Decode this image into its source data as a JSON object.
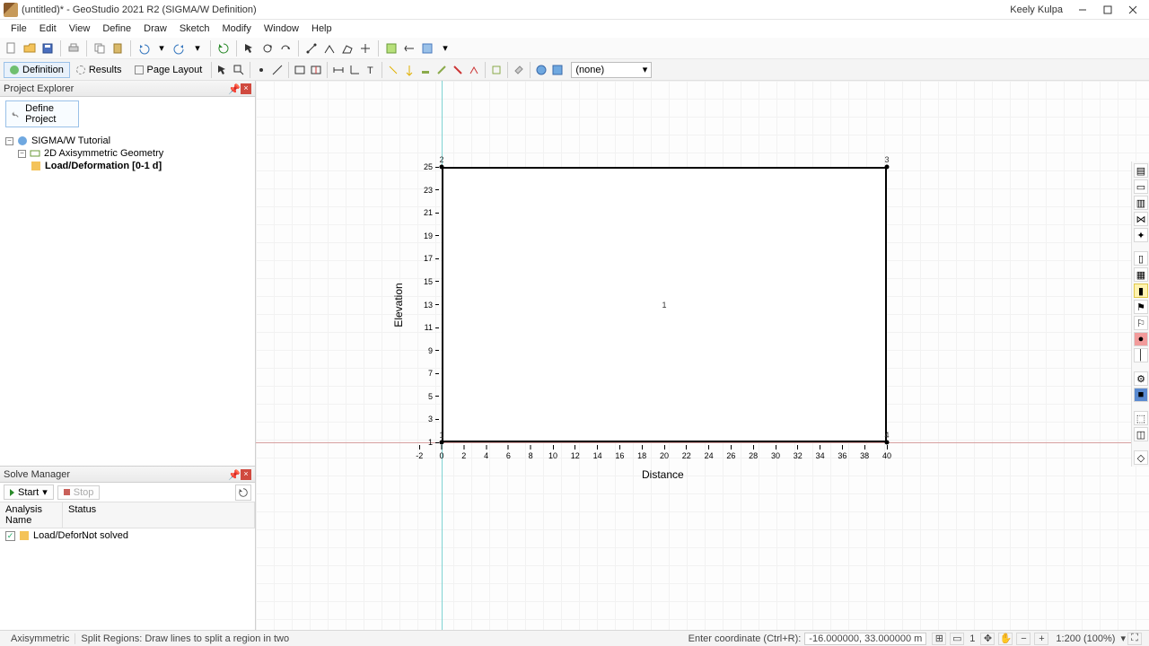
{
  "window": {
    "title": "(untitled)* - GeoStudio 2021 R2 (SIGMA/W Definition)",
    "user": "Keely Kulpa"
  },
  "menu": [
    "File",
    "Edit",
    "View",
    "Define",
    "Draw",
    "Sketch",
    "Modify",
    "Window",
    "Help"
  ],
  "modes": {
    "definition": "Definition",
    "results": "Results",
    "pagelayout": "Page Layout",
    "layer_selected": "(none)"
  },
  "project_explorer": {
    "title": "Project Explorer",
    "define_project": "Define Project",
    "root": "SIGMA/W Tutorial",
    "geometry": "2D Axisymmetric Geometry",
    "analysis": "Load/Deformation [0-1 d]"
  },
  "solve_manager": {
    "title": "Solve Manager",
    "start": "Start",
    "stop": "Stop",
    "col_name": "Analysis Name",
    "col_status": "Status",
    "row_name": "Load/Defor…",
    "row_status": "Not solved"
  },
  "chart_data": {
    "type": "region",
    "xlabel": "Distance",
    "ylabel": "Elevation",
    "xlim": [
      -2,
      40
    ],
    "ylim": [
      -2,
      25
    ],
    "xticks": [
      -2,
      0,
      2,
      4,
      6,
      8,
      10,
      12,
      14,
      16,
      18,
      20,
      22,
      24,
      26,
      28,
      30,
      32,
      34,
      36,
      38,
      40
    ],
    "yticks": [
      1,
      3,
      5,
      7,
      9,
      11,
      13,
      15,
      17,
      19,
      21,
      23,
      25
    ],
    "region": {
      "id": "1",
      "xmin": 0,
      "xmax": 40,
      "ymin": 1,
      "ymax": 25
    },
    "points": [
      {
        "id": "1",
        "x": 0,
        "y": 1
      },
      {
        "id": "2",
        "x": 0,
        "y": 25
      },
      {
        "id": "3",
        "x": 40,
        "y": 25
      },
      {
        "id": "4",
        "x": 40,
        "y": 1
      }
    ],
    "crosshair": {
      "x": 0,
      "y": 1
    }
  },
  "status": {
    "mode": "Axisymmetric",
    "hint": "Split Regions: Draw lines to split a region in two",
    "coord_label": "Enter coordinate (Ctrl+R):",
    "coord_value": "-16.000000, 33.000000 m",
    "page": "1",
    "zoom": "1:200 (100%)"
  }
}
